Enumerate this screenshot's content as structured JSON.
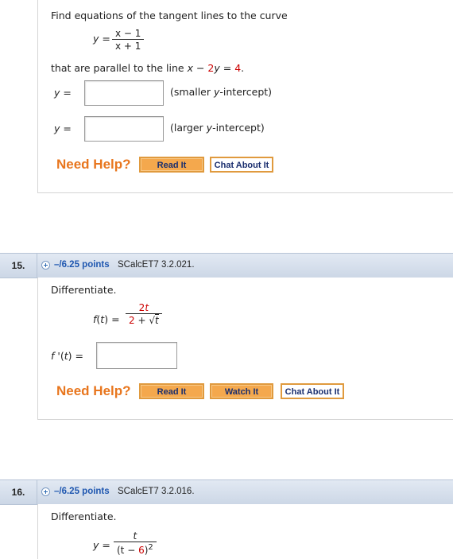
{
  "q14": {
    "prompt": "Find equations of the tangent lines to the curve",
    "curve": {
      "lhs": "y",
      "eq": "=",
      "num": "x − 1",
      "den": "x + 1"
    },
    "parallel_prefix": "that are parallel to the line ",
    "line": {
      "x": "x",
      "minus": " − ",
      "coef": "2",
      "y": "y",
      "eq": " = ",
      "rhs": "4",
      "dot": "."
    },
    "answers": [
      {
        "label": "y",
        "eq": "=",
        "value": "",
        "note_pre": "(smaller ",
        "note_var": "y",
        "note_post": "-intercept)"
      },
      {
        "label": "y",
        "eq": "=",
        "value": "",
        "note_pre": "(larger ",
        "note_var": "y",
        "note_post": "-intercept)"
      }
    ],
    "need_help": "Need Help?",
    "buttons": [
      "Read It",
      "Chat About It"
    ]
  },
  "q15": {
    "number": "15.",
    "points": "–/6.25 points",
    "course": "SCalcET7 3.2.021.",
    "prompt": "Differentiate.",
    "func": {
      "lhs": "f(t)",
      "eq": "=",
      "num_coef": "2",
      "num_var": "t",
      "den_coef": "2",
      "den_plus": " + ",
      "den_var": "t"
    },
    "answer": {
      "label": "f '(t)",
      "eq": "=",
      "value": ""
    },
    "need_help": "Need Help?",
    "buttons": [
      "Read It",
      "Watch It",
      "Chat About It"
    ]
  },
  "q16": {
    "number": "16.",
    "points": "–/6.25 points",
    "course": "SCalcET7 3.2.016.",
    "prompt": "Differentiate.",
    "func": {
      "lhs": "y",
      "eq": "=",
      "num": "t",
      "den_pre": "(t − ",
      "den_num": "6",
      "den_post": ")",
      "exp": "2"
    }
  },
  "colors": {
    "accent": "#e8761e",
    "button": "#f4a84d",
    "header": "#ccd7e6",
    "points": "#1f57b0"
  }
}
